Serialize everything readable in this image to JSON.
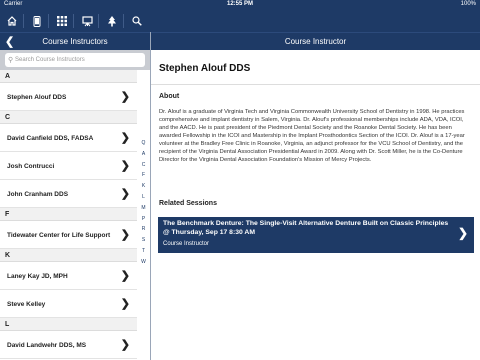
{
  "status_bar": {
    "carrier": "Carrier",
    "time": "12:55 PM",
    "battery": "100%"
  },
  "toolbar": {
    "icons": [
      "home-icon",
      "phone-icon",
      "grid-icon",
      "easel-icon",
      "tree-icon",
      "search-icon"
    ]
  },
  "left_header": {
    "title": "Course Instructors"
  },
  "right_header": {
    "title": "Course Instructor"
  },
  "search": {
    "placeholder": "Search Course Instructors"
  },
  "sections": [
    {
      "letter": "A",
      "items": [
        "Stephen Alouf DDS"
      ]
    },
    {
      "letter": "C",
      "items": [
        "David Canfield DDS, FADSA",
        "Josh Contrucci",
        "John Cranham DDS"
      ]
    },
    {
      "letter": "F",
      "items": [
        "Tidewater Center for Life Support"
      ]
    },
    {
      "letter": "K",
      "items": [
        "Laney Kay JD, MPH",
        "Steve Kelley"
      ]
    },
    {
      "letter": "L",
      "items": [
        "David Landwehr DDS, MS"
      ]
    }
  ],
  "index_letters": [
    "Q",
    "A",
    "C",
    "F",
    "K",
    "L",
    "M",
    "P",
    "R",
    "S",
    "T",
    "W"
  ],
  "detail": {
    "name": "Stephen Alouf DDS",
    "about_heading": "About",
    "about_text": "Dr. Alouf is a graduate of Virginia Tech and Virginia Commonwealth University School of Dentistry in 1998. He practices comprehensive and implant dentistry in Salem, Virginia. Dr. Alouf's professional memberships include ADA, VDA, ICOI, and the AACD. He is past president of the Piedmont Dental Society and the Roanoke Dental Society. He has been awarded Fellowship in the ICOI and Mastership in the Implant Prosthodontics Section of the ICOI. Dr. Alouf is a 17-year volunteer at the Bradley Free Clinic in Roanoke, Virginia, an adjunct professor for the VCU School of Dentistry, and the recipient of the Virginia Dental Association Presidential Award in 2009. Along with Dr. Scott Miller, he is the Co-Denture Director for the Virginia Dental Association Foundation's Mission of Mercy Projects.",
    "related_heading": "Related Sessions",
    "session": {
      "title": "The Benchmark Denture: The Single-Visit Alternative Denture Built on Classic Principles @ Thursday, Sep 17 8:30 AM",
      "role": "Course Instructor"
    }
  }
}
